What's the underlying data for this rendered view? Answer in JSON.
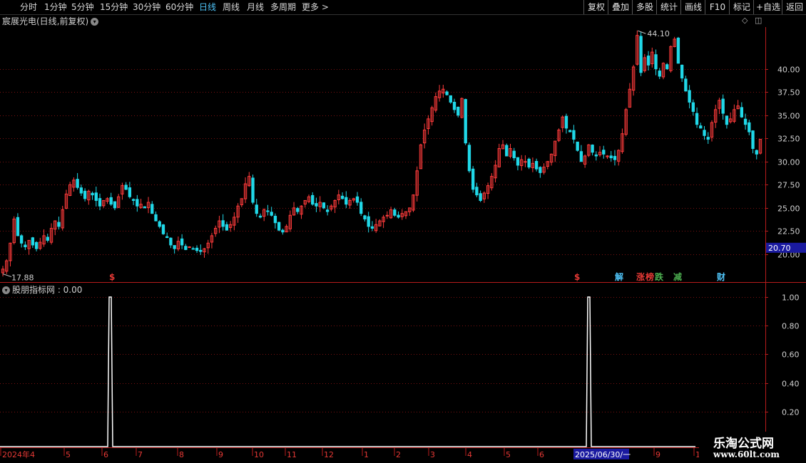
{
  "toolbar": {
    "periods": [
      {
        "label": "分时",
        "active": false
      },
      {
        "label": "1分钟",
        "active": false
      },
      {
        "label": "5分钟",
        "active": false
      },
      {
        "label": "15分钟",
        "active": false
      },
      {
        "label": "30分钟",
        "active": false
      },
      {
        "label": "60分钟",
        "active": false
      },
      {
        "label": "日线",
        "active": true
      },
      {
        "label": "周线",
        "active": false
      },
      {
        "label": "月线",
        "active": false
      },
      {
        "label": "多周期",
        "active": false
      },
      {
        "label": "更多 >",
        "active": false
      }
    ],
    "right_buttons": [
      "复权",
      "叠加",
      "多股",
      "统计",
      "画线",
      "F10",
      "标记",
      "+自选",
      "返回"
    ]
  },
  "chart_title": "宸展光电(日线,前复权)",
  "indicator_title": "股朋指标网 : 0.00",
  "price_axis": {
    "ticks": [
      {
        "label": "40.00",
        "value": 40.0
      },
      {
        "label": "37.50",
        "value": 37.5
      },
      {
        "label": "35.00",
        "value": 35.0
      },
      {
        "label": "32.50",
        "value": 32.5
      },
      {
        "label": "30.00",
        "value": 30.0
      },
      {
        "label": "27.50",
        "value": 27.5
      },
      {
        "label": "25.00",
        "value": 25.0
      },
      {
        "label": "22.50",
        "value": 22.5
      },
      {
        "label": "20.00",
        "value": 20.0
      }
    ],
    "current_price": "20.70",
    "high_label": "44.10",
    "low_label": "17.88"
  },
  "indicator_axis": {
    "ticks": [
      {
        "label": "1.00",
        "value": 1.0
      },
      {
        "label": "0.80",
        "value": 0.8
      },
      {
        "label": "0.60",
        "value": 0.6
      },
      {
        "label": "0.40",
        "value": 0.4
      },
      {
        "label": "0.20",
        "value": 0.2
      }
    ]
  },
  "event_markers": [
    {
      "label": "$",
      "color": "#e53935"
    },
    {
      "label": "$",
      "color": "#e53935"
    },
    {
      "label": "解",
      "color": "#4fc3f7"
    },
    {
      "label": "涨",
      "color": "#e53935"
    },
    {
      "label": "榜",
      "color": "#e53935"
    },
    {
      "label": "跌",
      "color": "#4caf50"
    },
    {
      "label": "减",
      "color": "#4caf50"
    },
    {
      "label": "财",
      "color": "#4fc3f7"
    }
  ],
  "date_axis": {
    "labels": [
      "2024年4",
      "5",
      "6",
      "7",
      "8",
      "9",
      "10",
      "11",
      "12",
      "1",
      "2",
      "3",
      "4",
      "5",
      "6",
      "7",
      "9",
      "1"
    ],
    "cursor_label": "2025/06/30/一"
  },
  "colors": {
    "up": "#ff3b3b",
    "down": "#20d8e8",
    "grid": "#7a1010",
    "axis": "#b71c1c",
    "indicator": "#ffffff"
  },
  "watermark": {
    "line1": "乐淘公式网",
    "line2": "www.60lt.com"
  },
  "chart_data": [
    {
      "type": "candlestick",
      "title": "宸展光电(日线,前复权)",
      "ylim": [
        17.0,
        44.5
      ],
      "series_close": [
        18.4,
        19.3,
        21.2,
        23.8,
        22.0,
        21.2,
        20.8,
        21.5,
        21.0,
        20.6,
        21.3,
        22.0,
        21.5,
        22.8,
        23.6,
        23.0,
        24.8,
        26.5,
        27.5,
        28.0,
        27.2,
        26.6,
        26.0,
        26.8,
        26.4,
        25.8,
        25.2,
        25.8,
        26.0,
        25.4,
        25.0,
        26.2,
        27.4,
        27.0,
        26.2,
        25.8,
        25.2,
        25.4,
        25.0,
        25.6,
        24.4,
        23.6,
        23.0,
        22.2,
        21.8,
        21.0,
        20.6,
        21.4,
        21.0,
        20.5,
        20.8,
        20.6,
        20.4,
        20.3,
        20.6,
        21.2,
        22.0,
        22.8,
        23.6,
        23.0,
        22.6,
        23.2,
        24.0,
        25.2,
        26.0,
        27.6,
        28.4,
        25.6,
        24.4,
        24.0,
        24.8,
        24.6,
        24.2,
        23.4,
        22.6,
        22.4,
        23.0,
        24.2,
        25.0,
        24.6,
        25.2,
        25.8,
        26.2,
        25.4,
        25.2,
        25.6,
        25.0,
        24.6,
        25.2,
        25.8,
        26.4,
        26.0,
        25.4,
        25.8,
        26.0,
        25.6,
        24.4,
        23.8,
        23.0,
        22.8,
        23.2,
        23.6,
        24.0,
        24.2,
        24.8,
        24.2,
        24.0,
        24.4,
        24.6,
        25.0,
        26.4,
        29.0,
        31.8,
        33.4,
        34.6,
        35.8,
        37.0,
        37.6,
        37.8,
        37.2,
        36.4,
        35.6,
        35.0,
        36.8,
        32.0,
        29.0,
        27.0,
        26.4,
        25.8,
        26.6,
        27.4,
        28.4,
        29.6,
        31.4,
        31.8,
        30.6,
        31.4,
        30.4,
        29.6,
        30.2,
        30.0,
        29.4,
        29.8,
        29.2,
        28.8,
        29.4,
        30.0,
        30.8,
        32.2,
        33.4,
        34.8,
        33.6,
        33.2,
        32.4,
        31.2,
        30.0,
        30.6,
        31.8,
        31.0,
        30.6,
        31.0,
        30.8,
        30.6,
        30.4,
        30.2,
        31.2,
        33.0,
        35.6,
        37.8,
        40.2,
        43.6,
        39.6,
        41.2,
        40.4,
        41.8,
        40.0,
        39.2,
        40.6,
        40.0,
        42.4,
        43.2,
        40.6,
        39.0,
        37.6,
        36.4,
        35.4,
        34.0,
        33.6,
        32.8,
        32.4,
        34.2,
        35.6,
        36.6,
        35.2,
        34.0,
        34.6,
        35.6,
        36.0,
        34.8,
        34.0,
        33.2,
        31.4,
        30.8,
        32.4
      ]
    },
    {
      "type": "line",
      "title": "股朋指标网",
      "ylim": [
        0,
        1.05
      ],
      "spikes": [
        {
          "index": 66,
          "value": 1.0
        },
        {
          "index": 354,
          "value": 1.0
        }
      ]
    }
  ]
}
